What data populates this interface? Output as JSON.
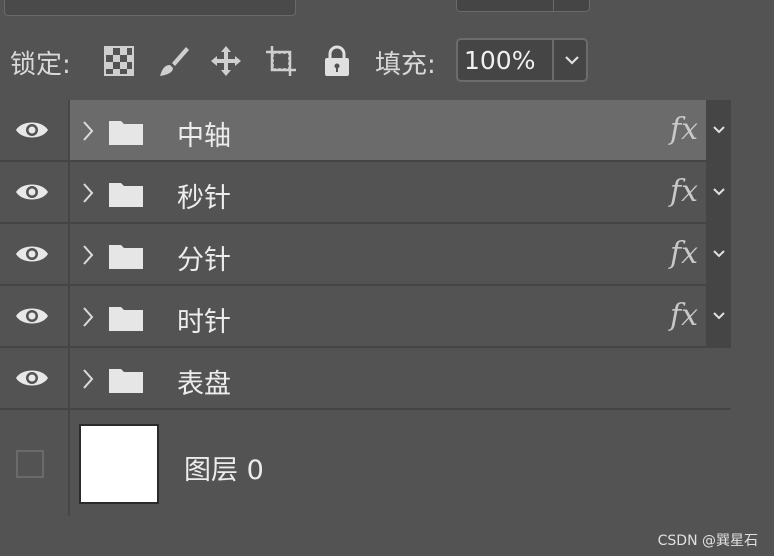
{
  "lock_bar": {
    "lock_label": "锁定:",
    "fill_label": "填充:",
    "fill_value": "100%"
  },
  "icons": {
    "lock_pixels": "checker-icon",
    "lock_paint": "brush-icon",
    "lock_move": "move-icon",
    "lock_artboard": "artboard-icon",
    "lock_all": "padlock-icon",
    "visibility": "eye-icon",
    "group": "folder-icon",
    "expand": "chevron-right-icon",
    "effects": "fx"
  },
  "layers": [
    {
      "name": "中轴",
      "fx": "fx",
      "selected": true
    },
    {
      "name": "秒针",
      "fx": "fx"
    },
    {
      "name": "分针",
      "fx": "fx"
    },
    {
      "name": "时针",
      "fx": "fx"
    },
    {
      "name": "表盘"
    }
  ],
  "background_layer": {
    "name": "图层 0"
  },
  "watermark": "CSDN @巽星石",
  "colors": {
    "panel_bg": "#535353",
    "selected_row": "#6b6b6b",
    "divider": "#454545"
  }
}
